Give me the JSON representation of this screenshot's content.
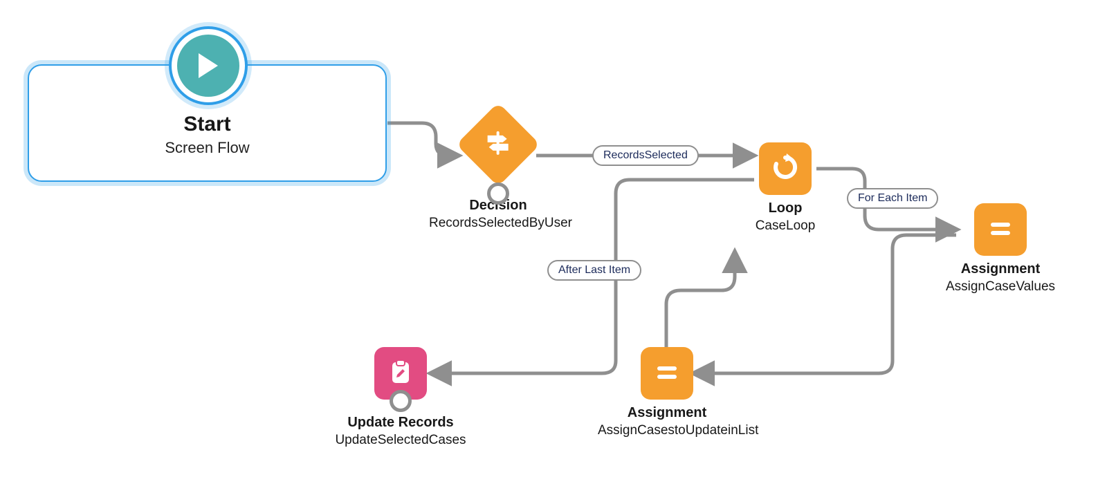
{
  "start": {
    "title": "Start",
    "subtitle": "Screen Flow"
  },
  "decision": {
    "title": "Decision",
    "subtitle": "RecordsSelectedByUser"
  },
  "loop": {
    "title": "Loop",
    "subtitle": "CaseLoop"
  },
  "assign1": {
    "title": "Assignment",
    "subtitle": "AssignCaseValues"
  },
  "assign2": {
    "title": "Assignment",
    "subtitle": "AssignCasestoUpdateinList"
  },
  "update": {
    "title": "Update Records",
    "subtitle": "UpdateSelectedCases"
  },
  "labels": {
    "recordsSelected": "RecordsSelected",
    "forEach": "For Each Item",
    "afterLast": "After Last Item"
  }
}
